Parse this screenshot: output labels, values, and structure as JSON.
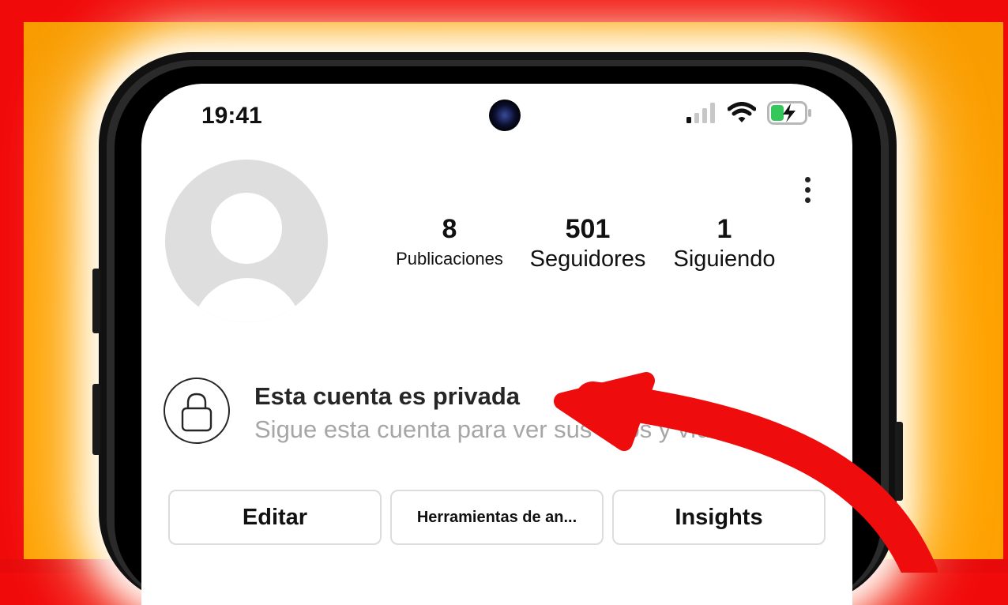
{
  "status_bar": {
    "time": "19:41",
    "icons": [
      "cellular-signal-icon",
      "wifi-icon",
      "battery-charging-icon"
    ]
  },
  "profile": {
    "stats": [
      {
        "value": "8",
        "label": "Publicaciones"
      },
      {
        "value": "501",
        "label": "Seguidores"
      },
      {
        "value": "1",
        "label": "Siguiendo"
      }
    ]
  },
  "private_notice": {
    "title": "Esta cuenta es privada",
    "subtitle": "Sigue esta cuenta para ver sus fotos y vídeos."
  },
  "buttons": {
    "edit": "Editar",
    "tools": "Herramientas de an...",
    "insights": "Insights"
  },
  "colors": {
    "frame_red": "#f10a0a",
    "background_orange": "#ffa200",
    "arrow_red": "#ee0c0c",
    "battery_green": "#34c759"
  }
}
